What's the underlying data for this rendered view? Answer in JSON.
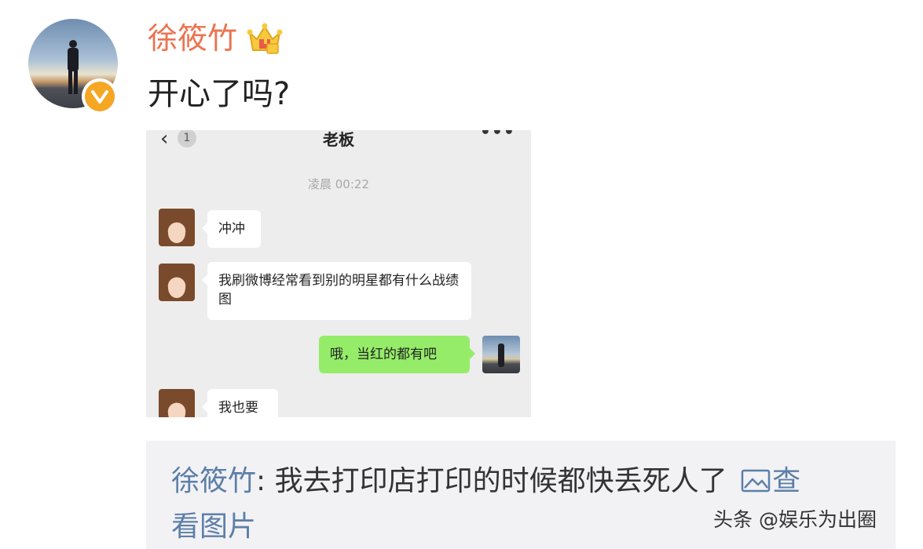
{
  "post": {
    "username": "徐筱竹",
    "text": "开心了吗?"
  },
  "chat": {
    "back_count": "1",
    "title": "老板",
    "more": "•••",
    "time": "凌晨 00:22",
    "messages": [
      {
        "side": "left",
        "text": "冲冲"
      },
      {
        "side": "left",
        "text": "我刷微博经常看到别的明星都有什么战绩图"
      },
      {
        "side": "right",
        "text": "哦，当红的都有吧"
      },
      {
        "side": "left",
        "text": "我也要"
      }
    ]
  },
  "repost": {
    "username": "徐筱竹",
    "separator": ":",
    "text": "我去打印店打印的时候都快丢死人了",
    "view_link_part1": "查",
    "view_link_part2": "看图片"
  },
  "watermark": "头条 @娱乐为出圈",
  "colors": {
    "username": "#eb7350",
    "link": "#5d7fa8",
    "verified_badge": "#f5a623",
    "wechat_green": "#95ec69"
  },
  "icons": [
    "verified-badge-icon",
    "crown-member-icon",
    "back-arrow-icon",
    "more-icon",
    "picture-icon"
  ]
}
